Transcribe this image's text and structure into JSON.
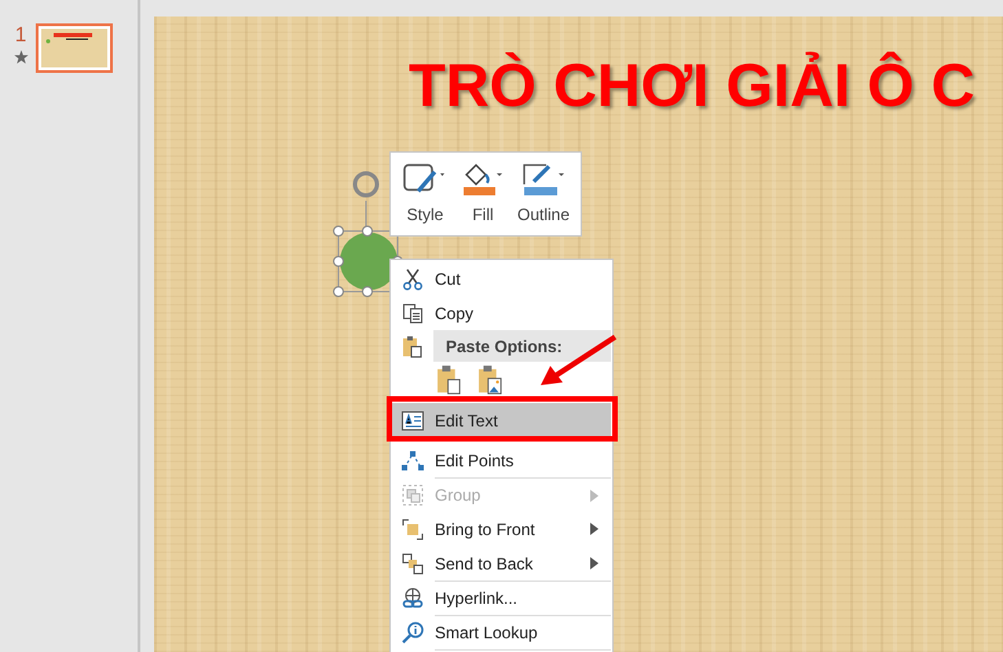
{
  "thumbnails": [
    {
      "number": "1",
      "selected": true,
      "has_animation": true
    }
  ],
  "slide": {
    "title": "TRÒ CHƠI GIẢI Ô C"
  },
  "mini_toolbar": [
    {
      "kind": "style",
      "label": "Style"
    },
    {
      "kind": "fill",
      "label": "Fill"
    },
    {
      "kind": "outline",
      "label": "Outline"
    }
  ],
  "context_menu": [
    {
      "kind": "cut",
      "label": "Cut",
      "disabled": false,
      "submenu": false,
      "selected": false,
      "separator_before": false
    },
    {
      "kind": "copy",
      "label": "Copy",
      "disabled": false,
      "submenu": false,
      "selected": false,
      "separator_before": false
    },
    {
      "kind": "header",
      "label": "Paste Options:"
    },
    {
      "kind": "paste_options"
    },
    {
      "kind": "edit_text",
      "label": "Edit Text",
      "disabled": false,
      "submenu": false,
      "selected": true,
      "separator_before": false
    },
    {
      "kind": "edit_points",
      "label": "Edit Points",
      "disabled": false,
      "submenu": false,
      "selected": false,
      "separator_before": false
    },
    {
      "kind": "group",
      "label": "Group",
      "disabled": true,
      "submenu": true,
      "selected": false,
      "separator_before": true
    },
    {
      "kind": "front",
      "label": "Bring to Front",
      "disabled": false,
      "submenu": true,
      "selected": false,
      "separator_before": false
    },
    {
      "kind": "back",
      "label": "Send to Back",
      "disabled": false,
      "submenu": true,
      "selected": false,
      "separator_before": false
    },
    {
      "kind": "link",
      "label": "Hyperlink...",
      "disabled": false,
      "submenu": false,
      "selected": false,
      "separator_before": true
    },
    {
      "kind": "lookup",
      "label": "Smart Lookup",
      "disabled": false,
      "submenu": false,
      "selected": false,
      "separator_before": true
    }
  ]
}
